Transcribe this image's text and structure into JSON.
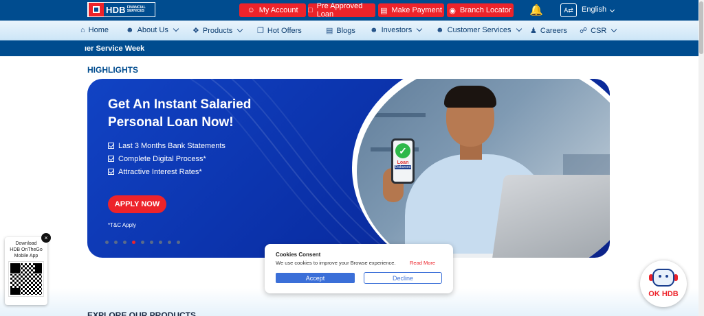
{
  "header": {
    "logo_text": "HDB",
    "logo_sub": "FINANCIAL SERVICES",
    "buttons": [
      {
        "label": "My Account",
        "icon": "user-icon"
      },
      {
        "label": "Pre Approved Loan",
        "icon": "bookmark-icon"
      },
      {
        "label": "Make Payment",
        "icon": "payment-icon"
      },
      {
        "label": "Branch Locator",
        "icon": "location-pin-icon"
      }
    ],
    "language": "English"
  },
  "nav": {
    "items": [
      {
        "label": "Home",
        "icon": "home-icon"
      },
      {
        "label": "About Us",
        "icon": "users-icon"
      },
      {
        "label": "Products",
        "icon": "cubes-icon"
      },
      {
        "label": "Hot Offers",
        "icon": "gift-icon"
      },
      {
        "label": "Blogs",
        "icon": "blog-icon"
      },
      {
        "label": "Investors",
        "icon": "group-icon"
      },
      {
        "label": "Customer Services",
        "icon": "support-icon"
      },
      {
        "label": "Careers",
        "icon": "person-icon"
      },
      {
        "label": "CSR",
        "icon": "handshake-icon"
      }
    ]
  },
  "marquee": {
    "text": "ıer Service Week"
  },
  "highlights": {
    "heading": "HIGHLIGHTS"
  },
  "banner": {
    "title": "Get An Instant Salaried Personal Loan Now!",
    "bullets": [
      "Last 3 Months Bank Statements",
      "Complete Digital Process*",
      "Attractive Interest Rates*"
    ],
    "cta": "APPLY NOW",
    "terms": "*T&C Apply",
    "phone_line1": "Loan",
    "phone_line2": "Disbursed",
    "slide_count": 9,
    "active_slide": 4
  },
  "app_widget": {
    "line1": "Download",
    "line2": "HDB OnTheGo",
    "line3": "Mobile App",
    "close": "×"
  },
  "cookies": {
    "title": "Cookies Consent",
    "text": "We use cookies to improve your Browse experience.",
    "read_more": "Read More",
    "accept": "Accept",
    "decline": "Decline"
  },
  "chatbot": {
    "label": "OK HDB"
  },
  "explore": {
    "heading": "EXPLORE OUR PRODUCTS"
  },
  "colors": {
    "brand_blue": "#004c8f",
    "brand_red": "#ed232a"
  }
}
